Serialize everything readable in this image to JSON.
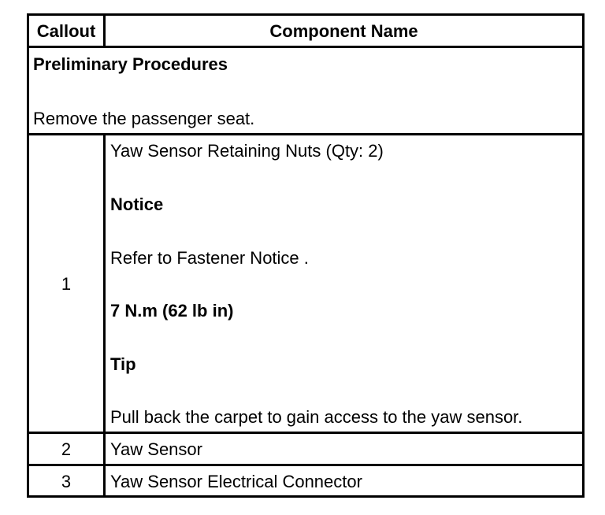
{
  "table": {
    "headers": {
      "callout": "Callout",
      "component_name": "Component Name"
    },
    "preliminary": {
      "heading": "Preliminary Procedures",
      "text": "Remove the passenger seat."
    },
    "rows": [
      {
        "callout": "1",
        "name": "Yaw Sensor Retaining Nuts (Qty: 2)",
        "notice_heading": "Notice",
        "notice_text": "Refer to Fastener Notice .",
        "torque": "7 N.m (62 lb in)",
        "tip_heading": "Tip",
        "tip_text": "Pull back the carpet to gain access to the yaw sensor."
      },
      {
        "callout": "2",
        "name": "Yaw Sensor"
      },
      {
        "callout": "3",
        "name": "Yaw Sensor Electrical Connector"
      }
    ]
  }
}
